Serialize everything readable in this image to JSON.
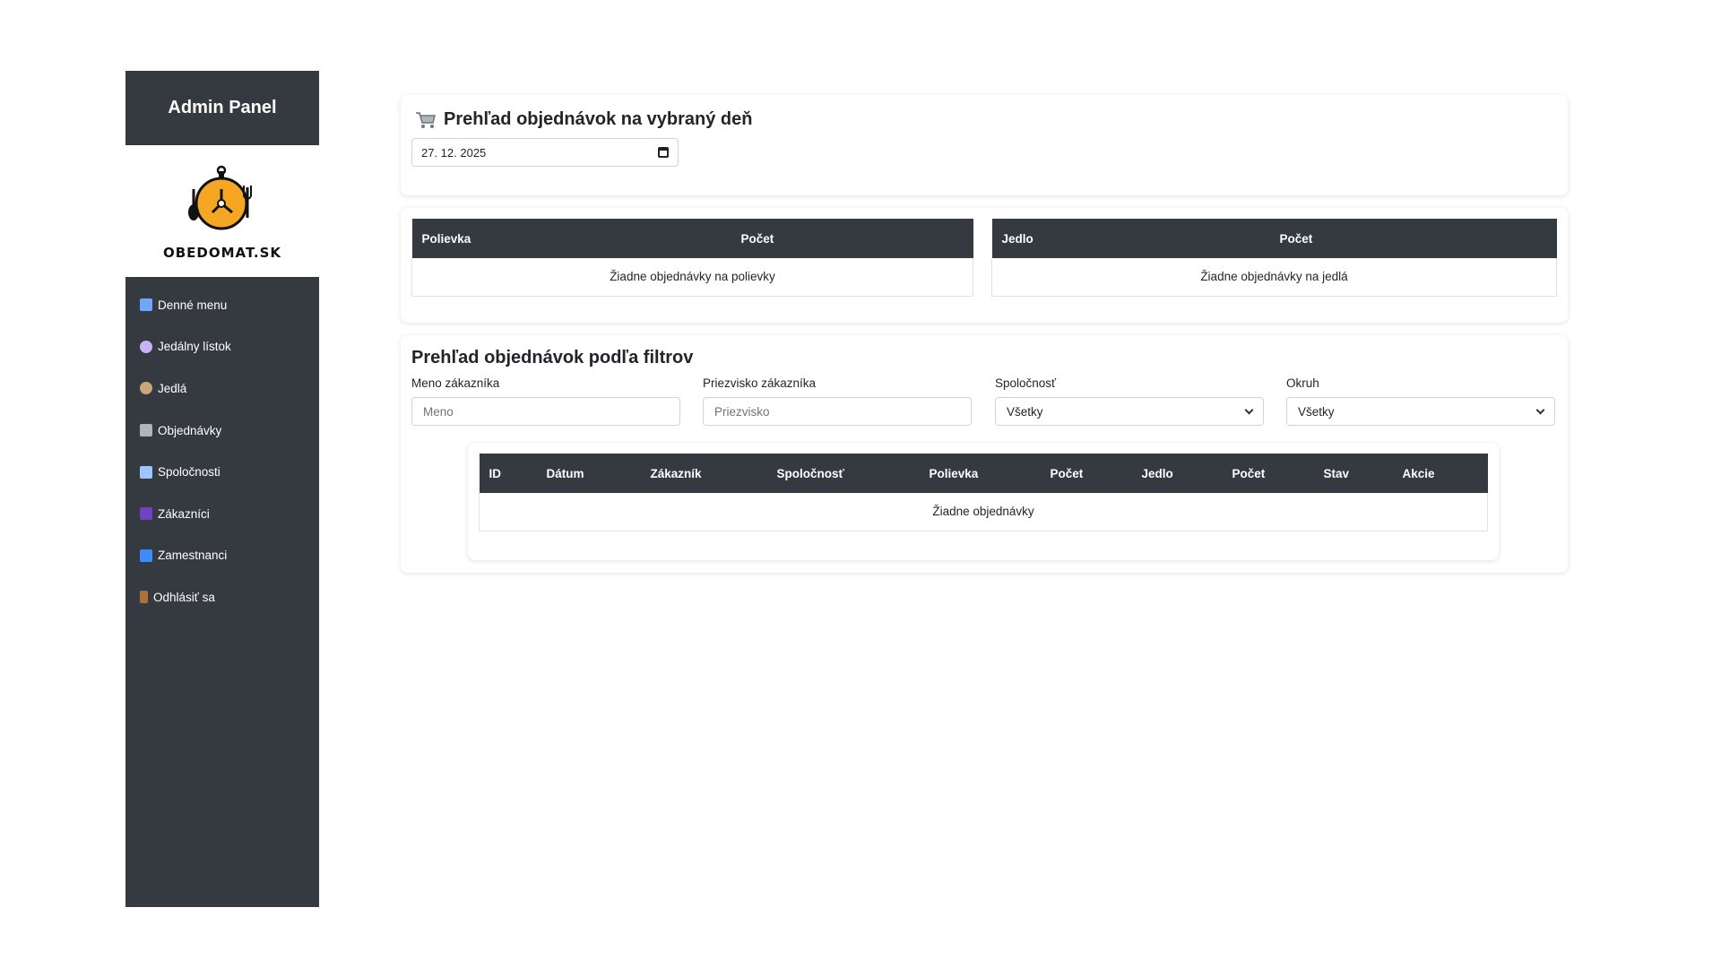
{
  "sidebar": {
    "title": "Admin Panel",
    "logo_text": "OBEDOMAT.SK",
    "items": [
      {
        "label": "Denné menu",
        "icon": "calendar-icon",
        "color": "#6ea8fe"
      },
      {
        "label": "Jedálny lístok",
        "icon": "plate-icon",
        "color": "#c9b3f5"
      },
      {
        "label": "Jedlá",
        "icon": "bowl-icon",
        "color": "#c8a87a"
      },
      {
        "label": "Objednávky",
        "icon": "cart-icon",
        "color": "#adb5bd"
      },
      {
        "label": "Spoločnosti",
        "icon": "building-icon",
        "color": "#9ec5fe"
      },
      {
        "label": "Zákazníci",
        "icon": "people-icon",
        "color": "#6f42c1"
      },
      {
        "label": "Zamestnanci",
        "icon": "jeans-icon",
        "color": "#3d8bfd"
      },
      {
        "label": "Odhlásiť sa",
        "icon": "door-icon",
        "color": "#b0703a"
      }
    ]
  },
  "daily": {
    "title": "Prehľad objednávok na vybraný deň",
    "date_value": "27. 12. 2025"
  },
  "soups": {
    "headers": [
      "Polievka",
      "Počet"
    ],
    "empty": "Žiadne objednávky na polievky"
  },
  "meals": {
    "headers": [
      "Jedlo",
      "Počet"
    ],
    "empty": "Žiadne objednávky na jedlá"
  },
  "filters": {
    "title": "Prehľad objednávok podľa filtrov",
    "first_name_label": "Meno zákazníka",
    "first_name_placeholder": "Meno",
    "last_name_label": "Priezvisko zákazníka",
    "last_name_placeholder": "Priezvisko",
    "company_label": "Spoločnosť",
    "company_value": "Všetky",
    "region_label": "Okruh",
    "region_value": "Všetky"
  },
  "orders": {
    "headers": [
      "ID",
      "Dátum",
      "Zákazník",
      "Spoločnosť",
      "Polievka",
      "Počet",
      "Jedlo",
      "Počet",
      "Stav",
      "Akcie"
    ],
    "empty": "Žiadne objednávky"
  },
  "colors": {
    "sidebar_bg": "#343a40",
    "table_header_bg": "#343a40",
    "logo_accent": "#f5a623"
  }
}
